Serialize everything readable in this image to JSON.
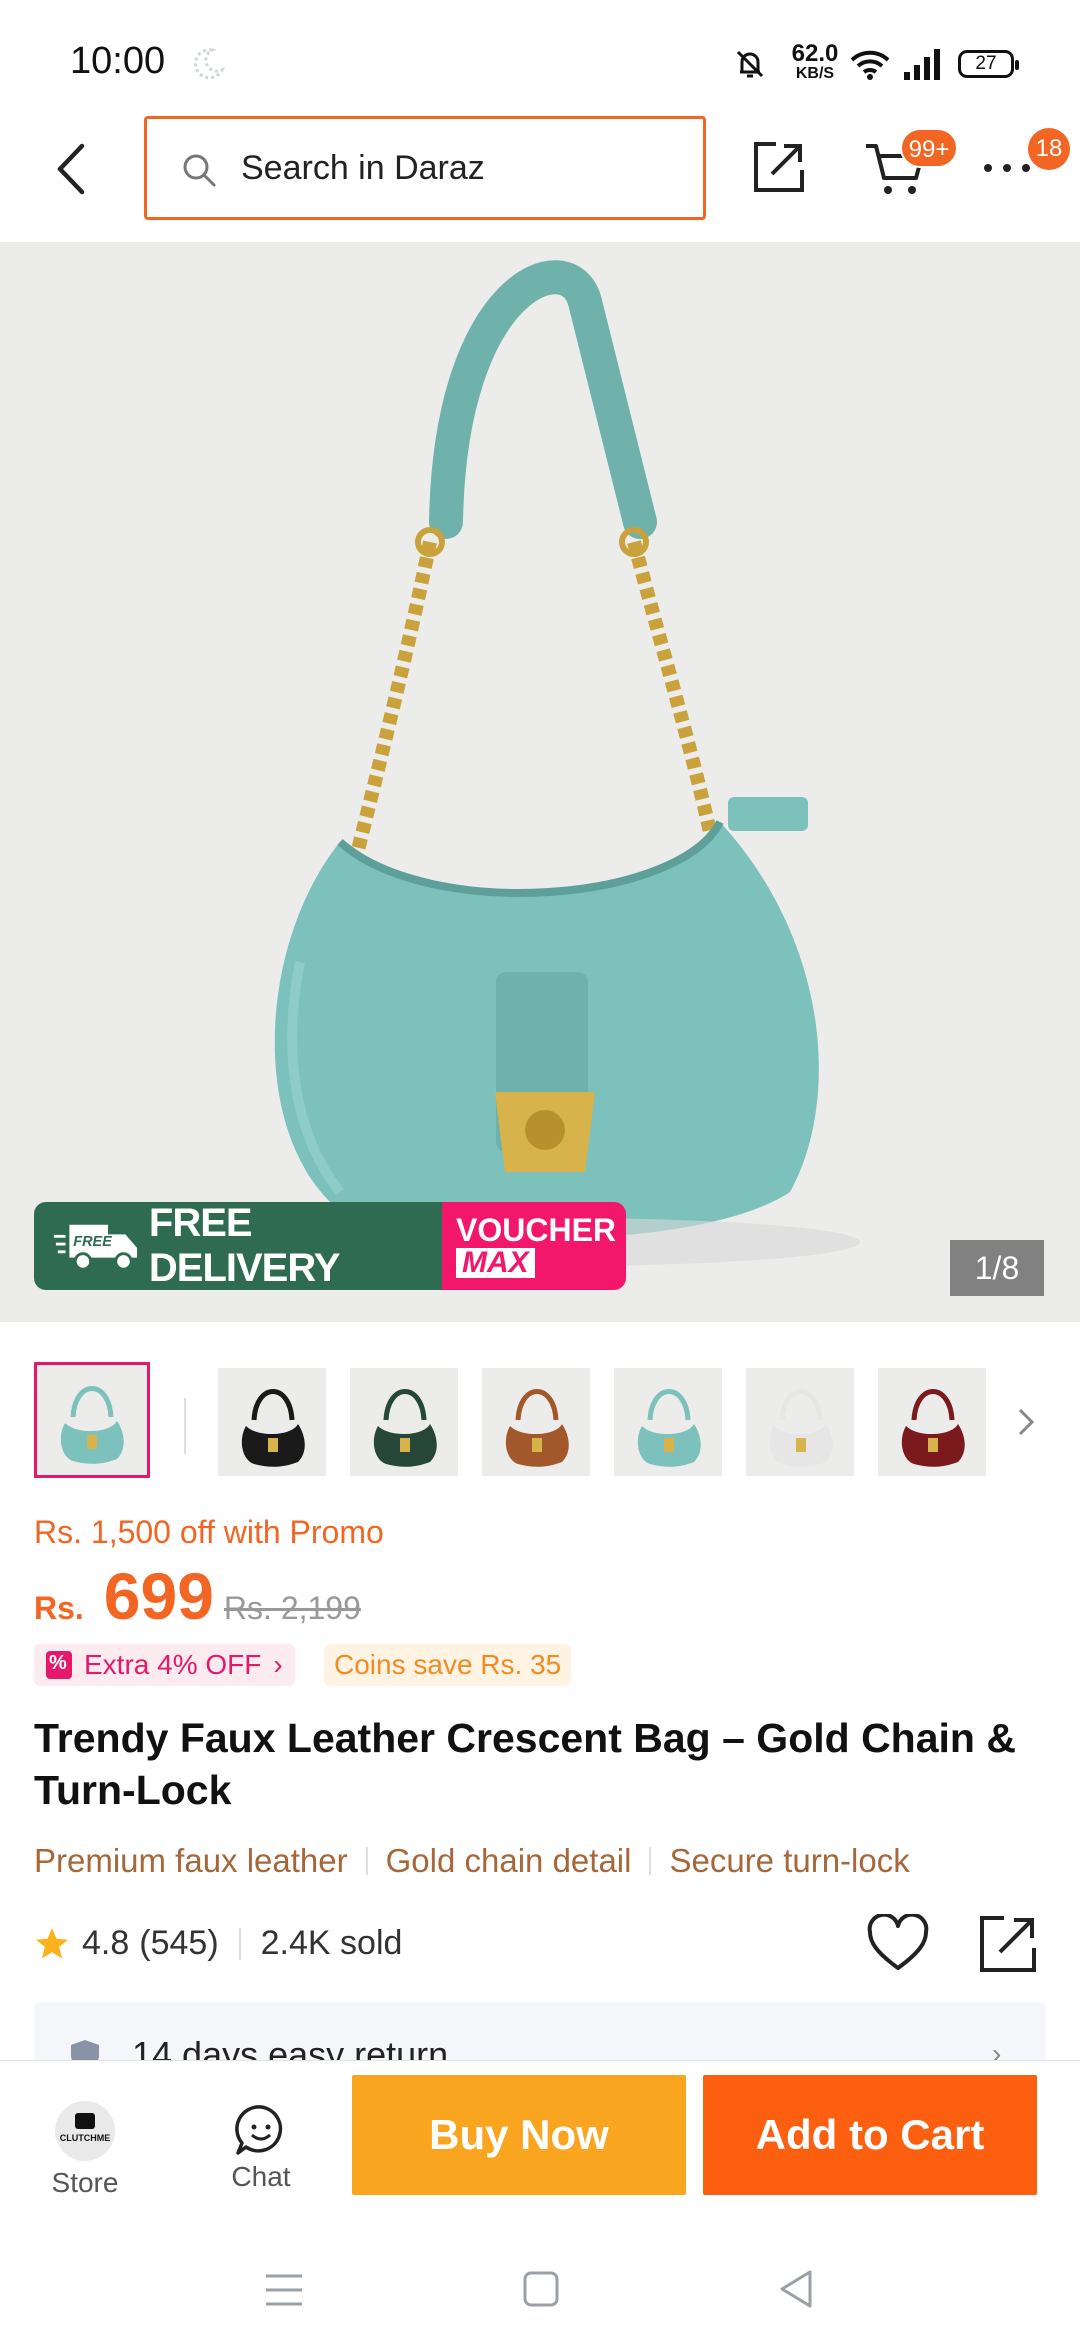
{
  "status_bar": {
    "time": "10:00",
    "net_speed_value": "62.0",
    "net_speed_unit": "KB/S",
    "battery": "27"
  },
  "header": {
    "search_placeholder": "Search in Daraz",
    "cart_badge": "99+",
    "more_badge": "18"
  },
  "hero": {
    "banner_free_delivery": "FREE DELIVERY",
    "banner_voucher": "VOUCHER",
    "banner_voucher_max": "MAX",
    "truck_badge": "FREE",
    "image_counter": "1/8",
    "bag_color": "#7cc1bb"
  },
  "thumbnails": [
    {
      "color": "#7cc1bb",
      "selected": true
    },
    {
      "color": "#1a1a1a",
      "selected": false
    },
    {
      "color": "#27463a",
      "selected": false
    },
    {
      "color": "#a2582b",
      "selected": false
    },
    {
      "color": "#7cc1bb",
      "selected": false
    },
    {
      "color": "#e6e6e6",
      "selected": false
    },
    {
      "color": "#7a1a1d",
      "selected": false
    }
  ],
  "price": {
    "promo_line": "Rs. 1,500 off with Promo",
    "currency": "Rs.",
    "value": "699",
    "original": "Rs. 2,199",
    "tag_extra": "Extra 4% OFF",
    "tag_coins": "Coins save Rs. 35"
  },
  "product": {
    "title": "Trendy Faux Leather Crescent Bag – Gold Chain & Turn-Lock",
    "features": [
      "Premium faux leather",
      "Gold chain detail",
      "Secure turn-lock"
    ],
    "rating": "4.8",
    "reviews": "(545)",
    "sold": "2.4K sold"
  },
  "return_policy": {
    "text": "14 days easy return"
  },
  "actions": {
    "store_label": "Store",
    "store_logo_text": "CLUTCHME",
    "chat_label": "Chat",
    "buy_now": "Buy Now",
    "add_to_cart": "Add to Cart"
  },
  "colors": {
    "accent": "#f26522",
    "buy_now": "#faa520",
    "add_to_cart": "#fb5f0f",
    "feature_text": "#a6683a",
    "promo_green": "#2e6b50",
    "promo_pink": "#f2176b"
  }
}
